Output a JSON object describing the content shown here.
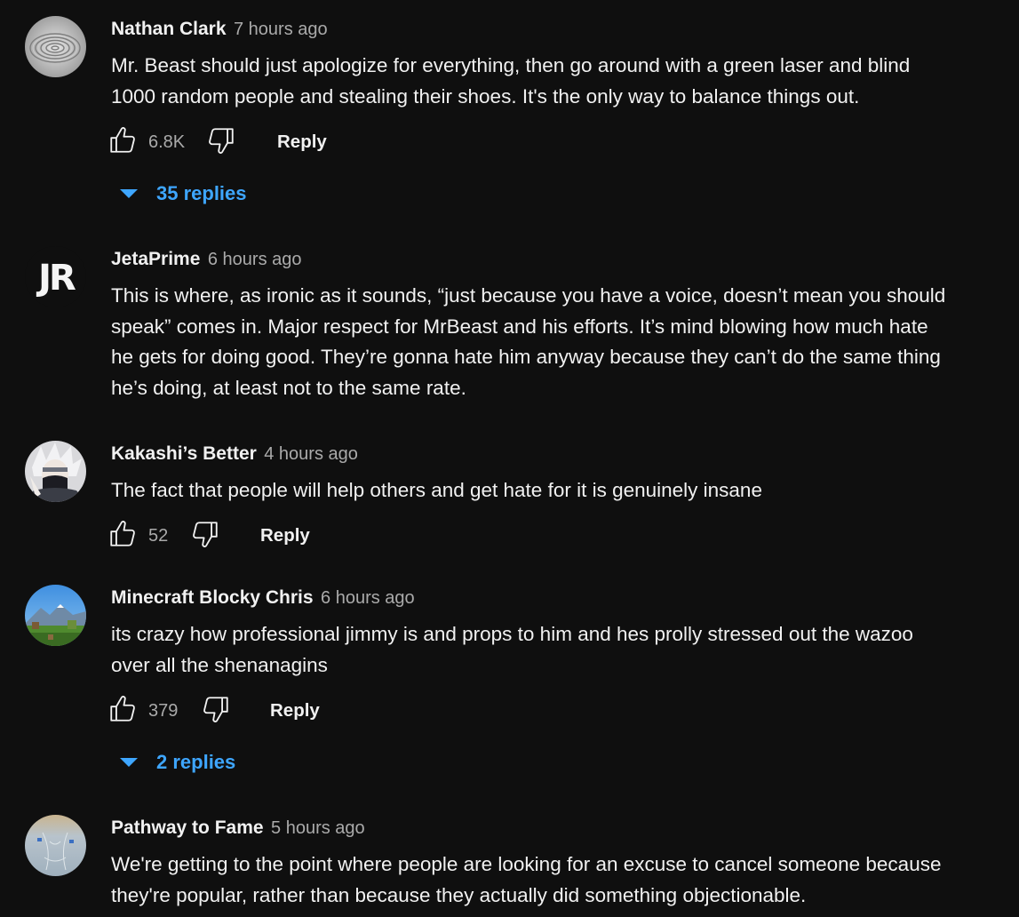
{
  "comments": [
    {
      "author": "Nathan Clark",
      "time": "7 hours ago",
      "lines": [
        "Mr. Beast should just apologize for everything, then go around with a green laser and blind",
        "1000 random people and stealing their shoes. It's the only way to balance things out."
      ],
      "likes": "6.8K",
      "reply_label": "Reply",
      "replies_label": "35 replies"
    },
    {
      "author": "JetaPrime",
      "time": "6 hours ago",
      "avatar_text": "JR",
      "lines": [
        "This is where, as ironic as it sounds, “just because you have a voice, doesn’t mean you should",
        "speak” comes in. Major respect for MrBeast and his efforts. It’s mind blowing how much hate",
        "he gets for doing good. They’re gonna hate him anyway because they can’t do the same thing",
        "he’s doing, at least not to the same rate."
      ]
    },
    {
      "author": "Kakashi’s Better",
      "time": "4 hours ago",
      "lines": [
        "The fact that people will help others and get hate for it is genuinely insane"
      ],
      "likes": "52",
      "reply_label": "Reply"
    },
    {
      "author": "Minecraft Blocky Chris",
      "time": "6 hours ago",
      "lines": [
        "its crazy how professional jimmy is and props to him and hes prolly stressed out the wazoo",
        "over all the shenanagins"
      ],
      "likes": "379",
      "reply_label": "Reply",
      "replies_label": "2 replies"
    },
    {
      "author": "Pathway to Fame",
      "time": "5 hours ago",
      "lines": [
        "We're getting to the point where people are looking for an excuse to cancel someone because",
        "they're popular, rather than because they actually did something objectionable."
      ]
    }
  ],
  "icons": {
    "like": "thumbs-up-icon",
    "dislike": "thumbs-down-icon",
    "expand": "caret-down-icon"
  },
  "colors": {
    "background": "#0f0f0f",
    "text": "#f1f1f1",
    "secondary_text": "#aaaaaa",
    "link": "#3ea6ff"
  }
}
